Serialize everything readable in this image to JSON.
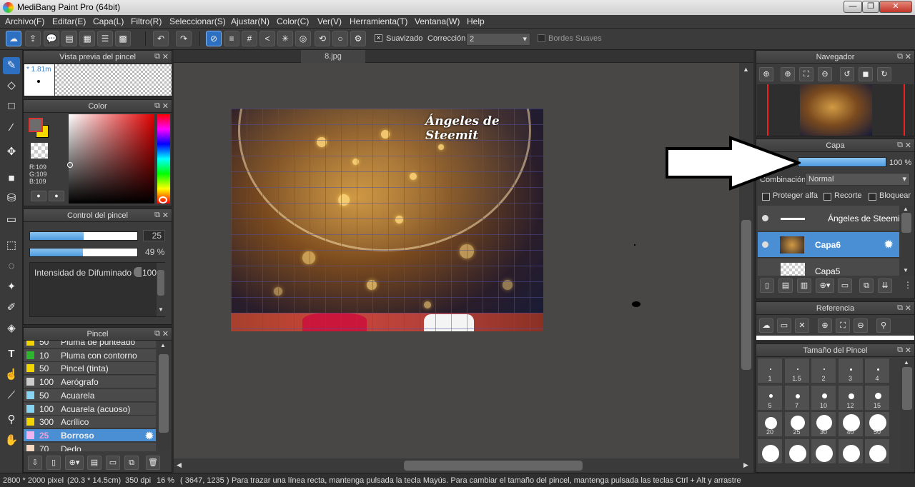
{
  "window": {
    "title": "MediBang Paint Pro (64bit)",
    "minimize": "—",
    "maximize": "❐",
    "close": "✕"
  },
  "menu": [
    "Archivo(F)",
    "Editar(E)",
    "Capa(L)",
    "Filtro(R)",
    "Seleccionar(S)",
    "Ajustar(N)",
    "Color(C)",
    "Ver(V)",
    "Herramienta(T)",
    "Ventana(W)",
    "Help"
  ],
  "toolbar": {
    "smooth_label": "Suavizado",
    "correction_label": "Corrección",
    "correction_value": "2",
    "soft_edges_label": "Bordes Suaves"
  },
  "brush_preview": {
    "title": "Vista previa del pincel",
    "size": "* 1.81m"
  },
  "color": {
    "title": "Color",
    "r": "R:109",
    "g": "G:109",
    "b": "B:109",
    "primary": "#6d6d6d",
    "secondary": "#f5d800"
  },
  "brush_control": {
    "title": "Control del pincel",
    "size_value": "25",
    "opacity_value": "49 %",
    "size_fraction": 0.5,
    "opacity_fraction": 0.49,
    "blur_label": "Intensidad de Difuminado",
    "blur_value": "100"
  },
  "brush_list": {
    "title": "Pincel",
    "items": [
      {
        "size": "50",
        "name": "Pluma de punteado",
        "color": "#f1d400"
      },
      {
        "size": "10",
        "name": "Pluma con contorno",
        "color": "#2db52d"
      },
      {
        "size": "50",
        "name": "Pincel (tinta)",
        "color": "#f1d400"
      },
      {
        "size": "100",
        "name": "Aerógrafo",
        "color": "#cccccc"
      },
      {
        "size": "50",
        "name": "Acuarela",
        "color": "#86d4f2"
      },
      {
        "size": "100",
        "name": "Acuarela (acuoso)",
        "color": "#86d4f2"
      },
      {
        "size": "300",
        "name": "Acrílico",
        "color": "#f1d400"
      },
      {
        "size": "25",
        "name": "Borroso",
        "color": "#f0b3f0"
      },
      {
        "size": "70",
        "name": "Dedo",
        "color": "#f8d8c0"
      }
    ]
  },
  "document": {
    "tab": "8.jpg",
    "art_title": "Ángeles de Steemit"
  },
  "navigator": {
    "title": "Navegador"
  },
  "layer": {
    "title": "Capa",
    "opacity": "100 %",
    "opacity_fraction": 1.0,
    "blend_label": "Combinación",
    "blend_value": "Normal",
    "protect_alpha": "Proteger alfa",
    "clip": "Recorte",
    "lock": "Bloquear",
    "layers": [
      {
        "name": "Ángeles de Steemit"
      },
      {
        "name": "Capa6"
      },
      {
        "name": "Capa5"
      }
    ]
  },
  "reference": {
    "title": "Referencia"
  },
  "brush_size": {
    "title": "Tamaño del Pincel",
    "sizes": [
      "1",
      "1.5",
      "2",
      "3",
      "4",
      "5",
      "7",
      "10",
      "12",
      "15",
      "20",
      "25",
      "30",
      "40",
      "50"
    ]
  },
  "status": {
    "dimensions": "2800 * 2000 pixel",
    "physical": "(20.3 * 14.5cm)",
    "dpi": "350 dpi",
    "zoom": "16 %",
    "coords": "( 3647, 1235 )",
    "hint": "Para trazar una línea recta, mantenga pulsada la tecla Mayús. Para cambiar el tamaño del pincel, mantenga pulsada las teclas Ctrl + Alt y arrastre"
  }
}
